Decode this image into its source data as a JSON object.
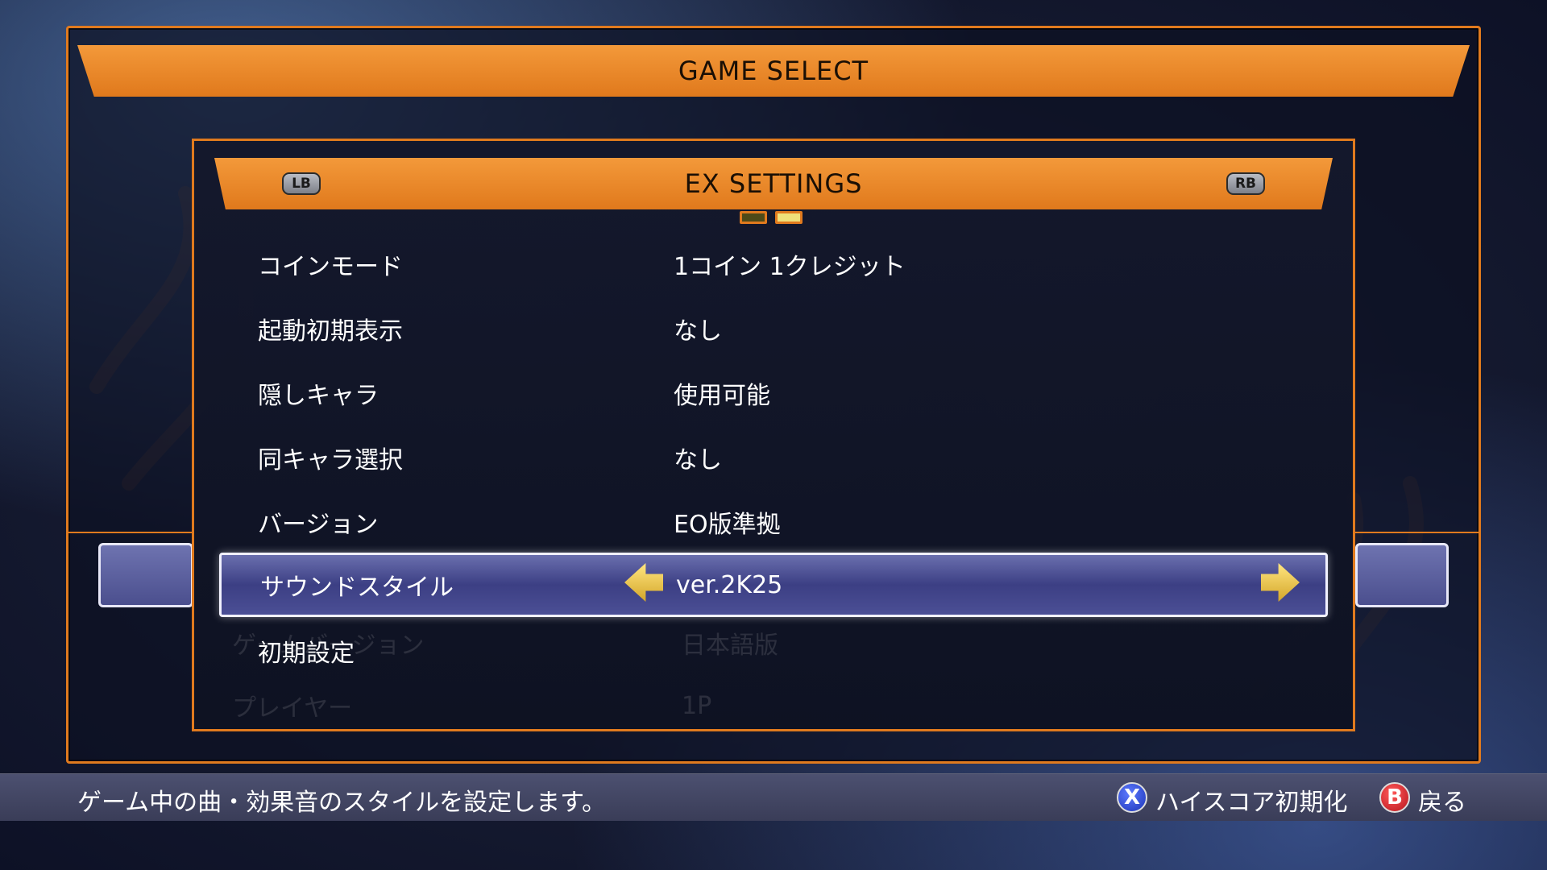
{
  "game_select": {
    "title": "GAME SELECT"
  },
  "ex_settings": {
    "title": "EX SETTINGS",
    "lb_label": "LB",
    "rb_label": "RB",
    "page_current": 2,
    "page_total": 2
  },
  "settings": [
    {
      "label": "コインモード",
      "value": "1コイン 1クレジット"
    },
    {
      "label": "起動初期表示",
      "value": "なし"
    },
    {
      "label": "隠しキャラ",
      "value": "使用可能"
    },
    {
      "label": "同キャラ選択",
      "value": "なし"
    },
    {
      "label": "バージョン",
      "value": "EO版準拠"
    },
    {
      "label": "サウンドスタイル",
      "value": "ver.2K25"
    },
    {
      "label": "初期設定",
      "value": ""
    }
  ],
  "background_rows": [
    {
      "label": "ゲームバージョン",
      "value": "日本語版"
    },
    {
      "label": "プレイヤー",
      "value": "1P"
    }
  ],
  "help": {
    "description": "ゲーム中の曲・効果音のスタイルを設定します。",
    "x_button": "X",
    "x_action": "ハイスコア初期化",
    "b_button": "B",
    "b_action": "戻る"
  },
  "colors": {
    "accent": "#e07a1e",
    "selected_row": "#4b4f95"
  }
}
